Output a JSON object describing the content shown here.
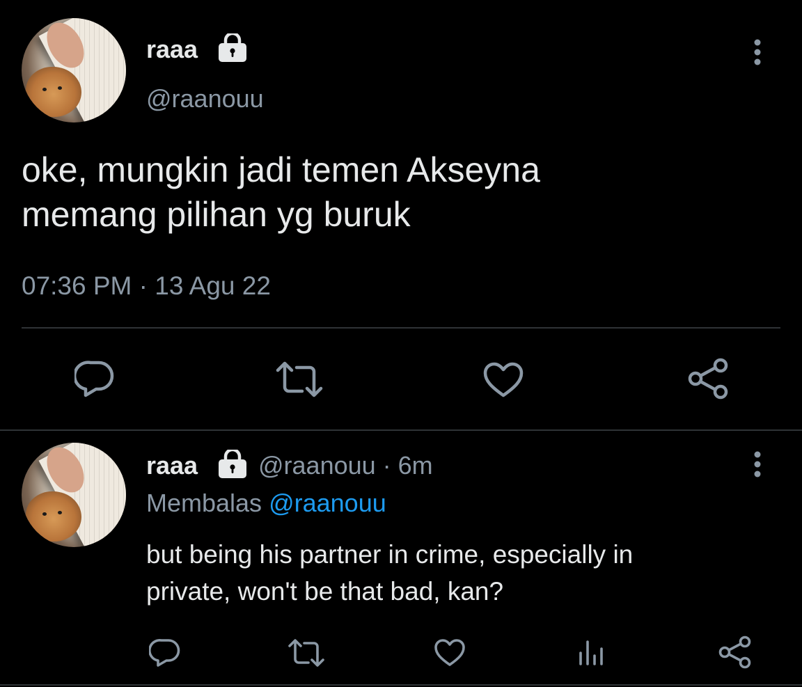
{
  "main_tweet": {
    "display_name": "raaa",
    "handle": "@raanouu",
    "text_line1": "oke, mungkin jadi temen Akseyna",
    "text_line2": "memang pilihan yg buruk",
    "timestamp": "07:36 PM · 13 Agu 22",
    "icons": [
      "lock-icon",
      "more-vertical-icon",
      "reply-icon",
      "retweet-icon",
      "like-icon",
      "share-icon"
    ]
  },
  "reply_tweet": {
    "display_name": "raaa",
    "handle_time": "@raanouu · 6m",
    "replying_prefix": "Membalas",
    "replying_to": "@raanouu",
    "text_line1": "but being his partner in crime, especially in",
    "text_line2": "private, won't be that bad, kan?",
    "icons": [
      "lock-icon",
      "more-vertical-icon",
      "reply-icon",
      "retweet-icon",
      "like-icon",
      "analytics-icon",
      "share-icon"
    ]
  },
  "colors": {
    "background": "#000000",
    "text": "#e7e9ea",
    "secondary": "#8b98a5",
    "link": "#1d9bf0",
    "divider": "#2f3336"
  }
}
